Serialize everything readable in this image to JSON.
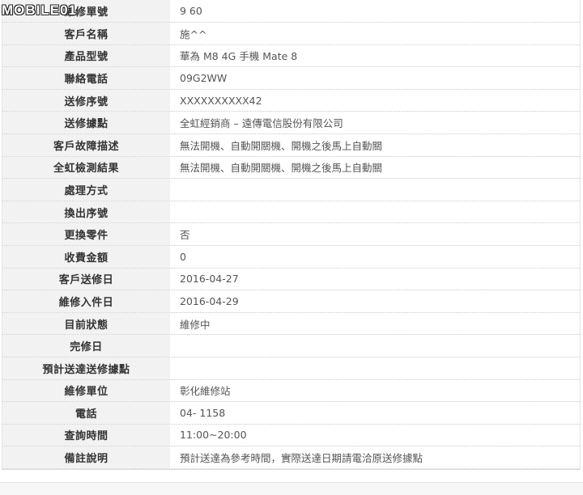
{
  "watermark": {
    "text": "MOBILE01"
  },
  "rows": [
    {
      "label": "維修單號",
      "value": "9          60"
    },
    {
      "label": "客戶名稱",
      "value": "施^^"
    },
    {
      "label": "產品型號",
      "value": "華為 M8 4G 手機 Mate 8"
    },
    {
      "label": "聯絡電話",
      "value": "09G2WW"
    },
    {
      "label": "送修序號",
      "value": "XXXXXXXXXX42"
    },
    {
      "label": "送修據點",
      "value": "全虹經銷商 – 遠傳電信股份有限公司"
    },
    {
      "label": "客戶故障描述",
      "value": "無法開機、自動開關機、開機之後馬上自動關"
    },
    {
      "label": "全虹檢測結果",
      "value": "無法開機、自動開關機、開機之後馬上自動關"
    },
    {
      "label": "處理方式",
      "value": ""
    },
    {
      "label": "換出序號",
      "value": ""
    },
    {
      "label": "更換零件",
      "value": "否"
    },
    {
      "label": "收費金額",
      "value": "0"
    },
    {
      "label": "客戶送修日",
      "value": "2016-04-27"
    },
    {
      "label": "維修入件日",
      "value": "2016-04-29"
    },
    {
      "label": "目前狀態",
      "value": "維修中"
    },
    {
      "label": "完修日",
      "value": ""
    },
    {
      "label": "預計送達送修據點",
      "value": ""
    },
    {
      "label": "維修單位",
      "value": "彰化維修站"
    },
    {
      "label": "電話",
      "value": "04-      1158"
    },
    {
      "label": "查詢時間",
      "value": "11:00~20:00"
    },
    {
      "label": "備註說明",
      "value": "預計送達為參考時間，實際送達日期請電洽原送修據點"
    }
  ]
}
